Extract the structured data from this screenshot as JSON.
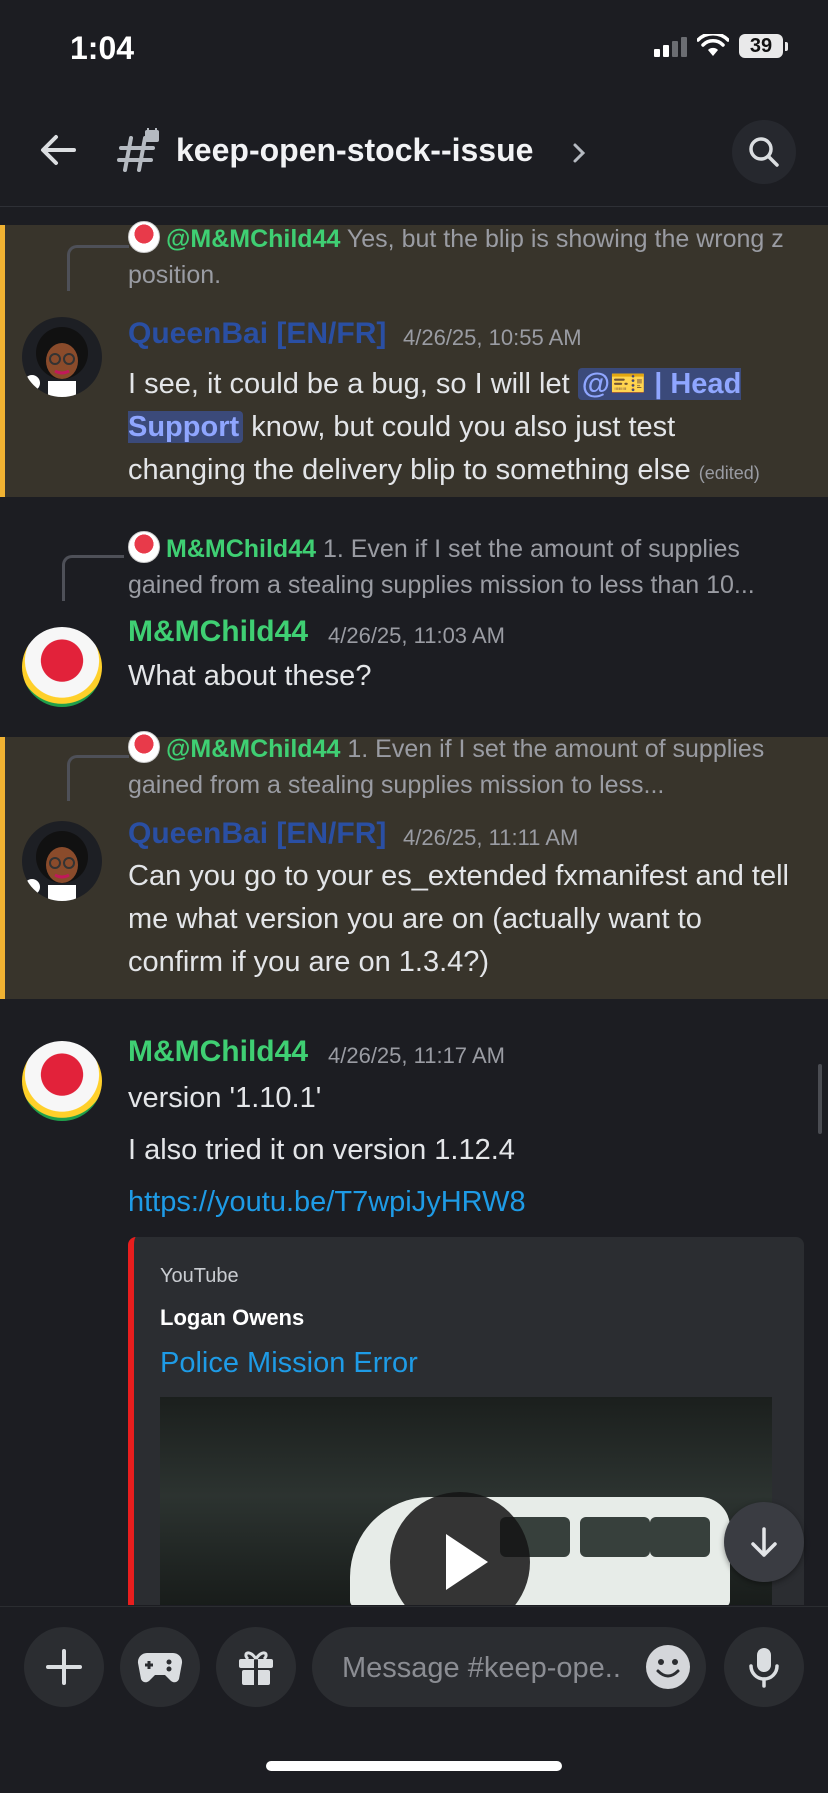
{
  "status_bar": {
    "time": "1:04",
    "battery": "39"
  },
  "header": {
    "channel_name": "keep-open-stock--issue"
  },
  "messages": [
    {
      "reply_author": "@M&MChild44",
      "reply_text": "Yes, but the blip is showing the wrong z position.",
      "author": "QueenBai [EN/FR]",
      "timestamp": "4/26/25, 10:55 AM",
      "text_before": "I see, it could be a bug, so I will let ",
      "mention": "@🎫 | Head Support",
      "text_after": " know, but could you also just test changing the delivery blip to something else",
      "edited": "(edited)"
    },
    {
      "reply_author": "M&MChild44",
      "reply_text": "1.   Even if I set the amount of supplies gained from a stealing supplies mission to less than 10...",
      "author": "M&MChild44",
      "timestamp": "4/26/25, 11:03 AM",
      "text": "What about these?"
    },
    {
      "reply_author": "@M&MChild44",
      "reply_text": "1.   Even if I set the amount of supplies gained from a stealing supplies mission to less...",
      "author": "QueenBai [EN/FR]",
      "timestamp": "4/26/25, 11:11 AM",
      "text": "Can you go to your es_extended fxmanifest and tell me what version you are on (actually want to confirm if you are on 1.3.4?)"
    },
    {
      "author": "M&MChild44",
      "timestamp": "4/26/25, 11:17 AM",
      "line1": "version '1.10.1'",
      "line2": "I also tried it on version 1.12.4",
      "link": "https://youtu.be/T7wpiJyHRW8",
      "embed": {
        "provider": "YouTube",
        "author": "Logan Owens",
        "title": "Police Mission Error"
      }
    }
  ],
  "composer": {
    "placeholder": "Message #keep-ope.."
  },
  "colors": {
    "mention_bg": "#38342b",
    "mention_bar": "#f0b232",
    "green_name": "#3fcf73",
    "link": "#1e9be6",
    "embed_bar": "#e81e1e"
  }
}
